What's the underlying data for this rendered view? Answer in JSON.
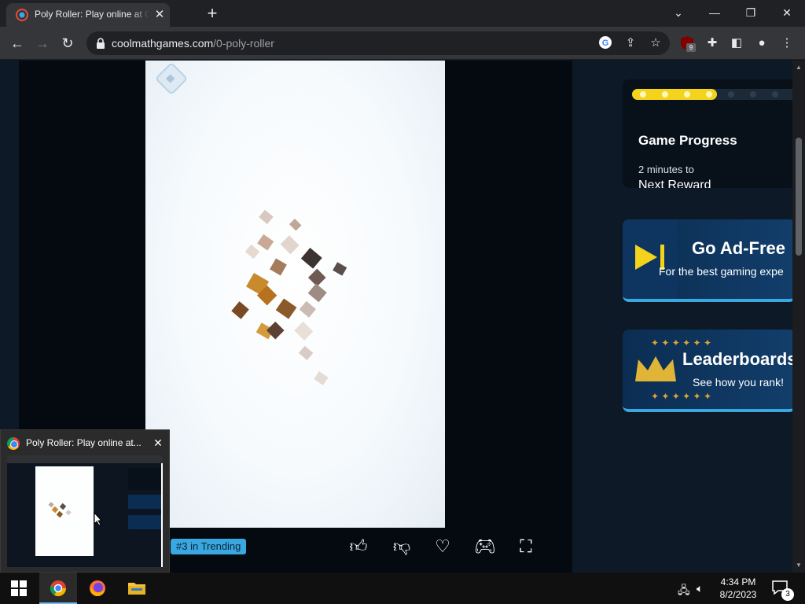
{
  "browser": {
    "tab_title": "Poly Roller: Play online at Coolmath Games",
    "url_domain": "coolmathgames.com",
    "url_path": "/0-poly-roller",
    "extension_badge": "9"
  },
  "game": {
    "trending_badge": "#3 in Trending",
    "actions": [
      "thumbs-up",
      "thumbs-down",
      "favorite",
      "gamepad",
      "fullscreen"
    ]
  },
  "sidebar": {
    "progress": {
      "title": "Game Progress",
      "sub": "2 minutes to",
      "reward": "Next Reward",
      "filled_dots": 4,
      "total_dots": 8
    },
    "adfree": {
      "title": "Go Ad-Free",
      "sub": "For the best gaming expe"
    },
    "leaderboards": {
      "title": "Leaderboards",
      "sub": "See how you rank!"
    }
  },
  "preview": {
    "title": "Poly Roller: Play online at..."
  },
  "taskbar": {
    "time": "4:34 PM",
    "date": "8/2/2023",
    "notification_count": "3"
  },
  "colors": {
    "accent_blue": "#3aa7e0",
    "progress_yellow": "#f3d31b",
    "gold": "#e0a437"
  }
}
